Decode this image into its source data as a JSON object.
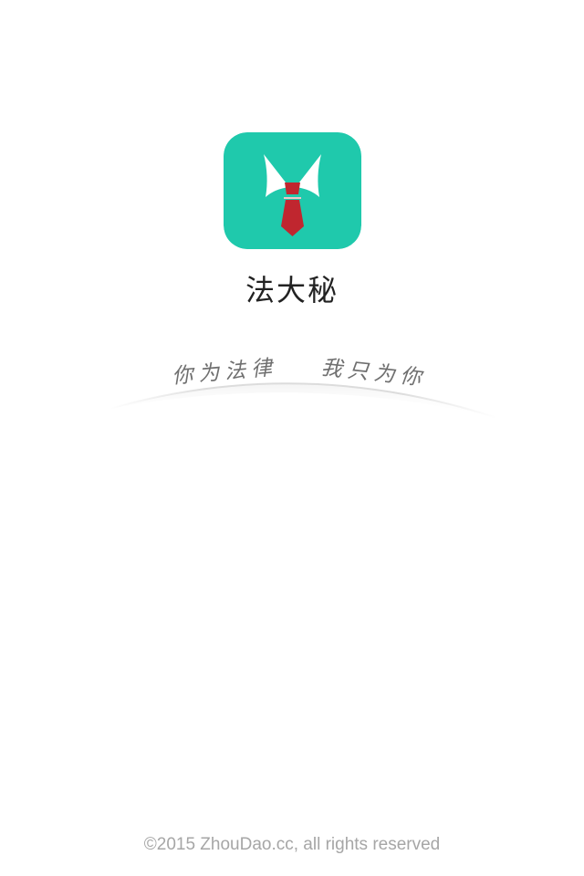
{
  "app": {
    "name": "法大秘",
    "logo_icon": "tie-collar-icon",
    "brand_color": "#1fc9ac",
    "tie_color": "#c0262f"
  },
  "slogan": {
    "left": "你为法律",
    "right": "我只为你"
  },
  "footer": {
    "copyright": "©2015 ZhouDao.cc, all rights reserved"
  }
}
